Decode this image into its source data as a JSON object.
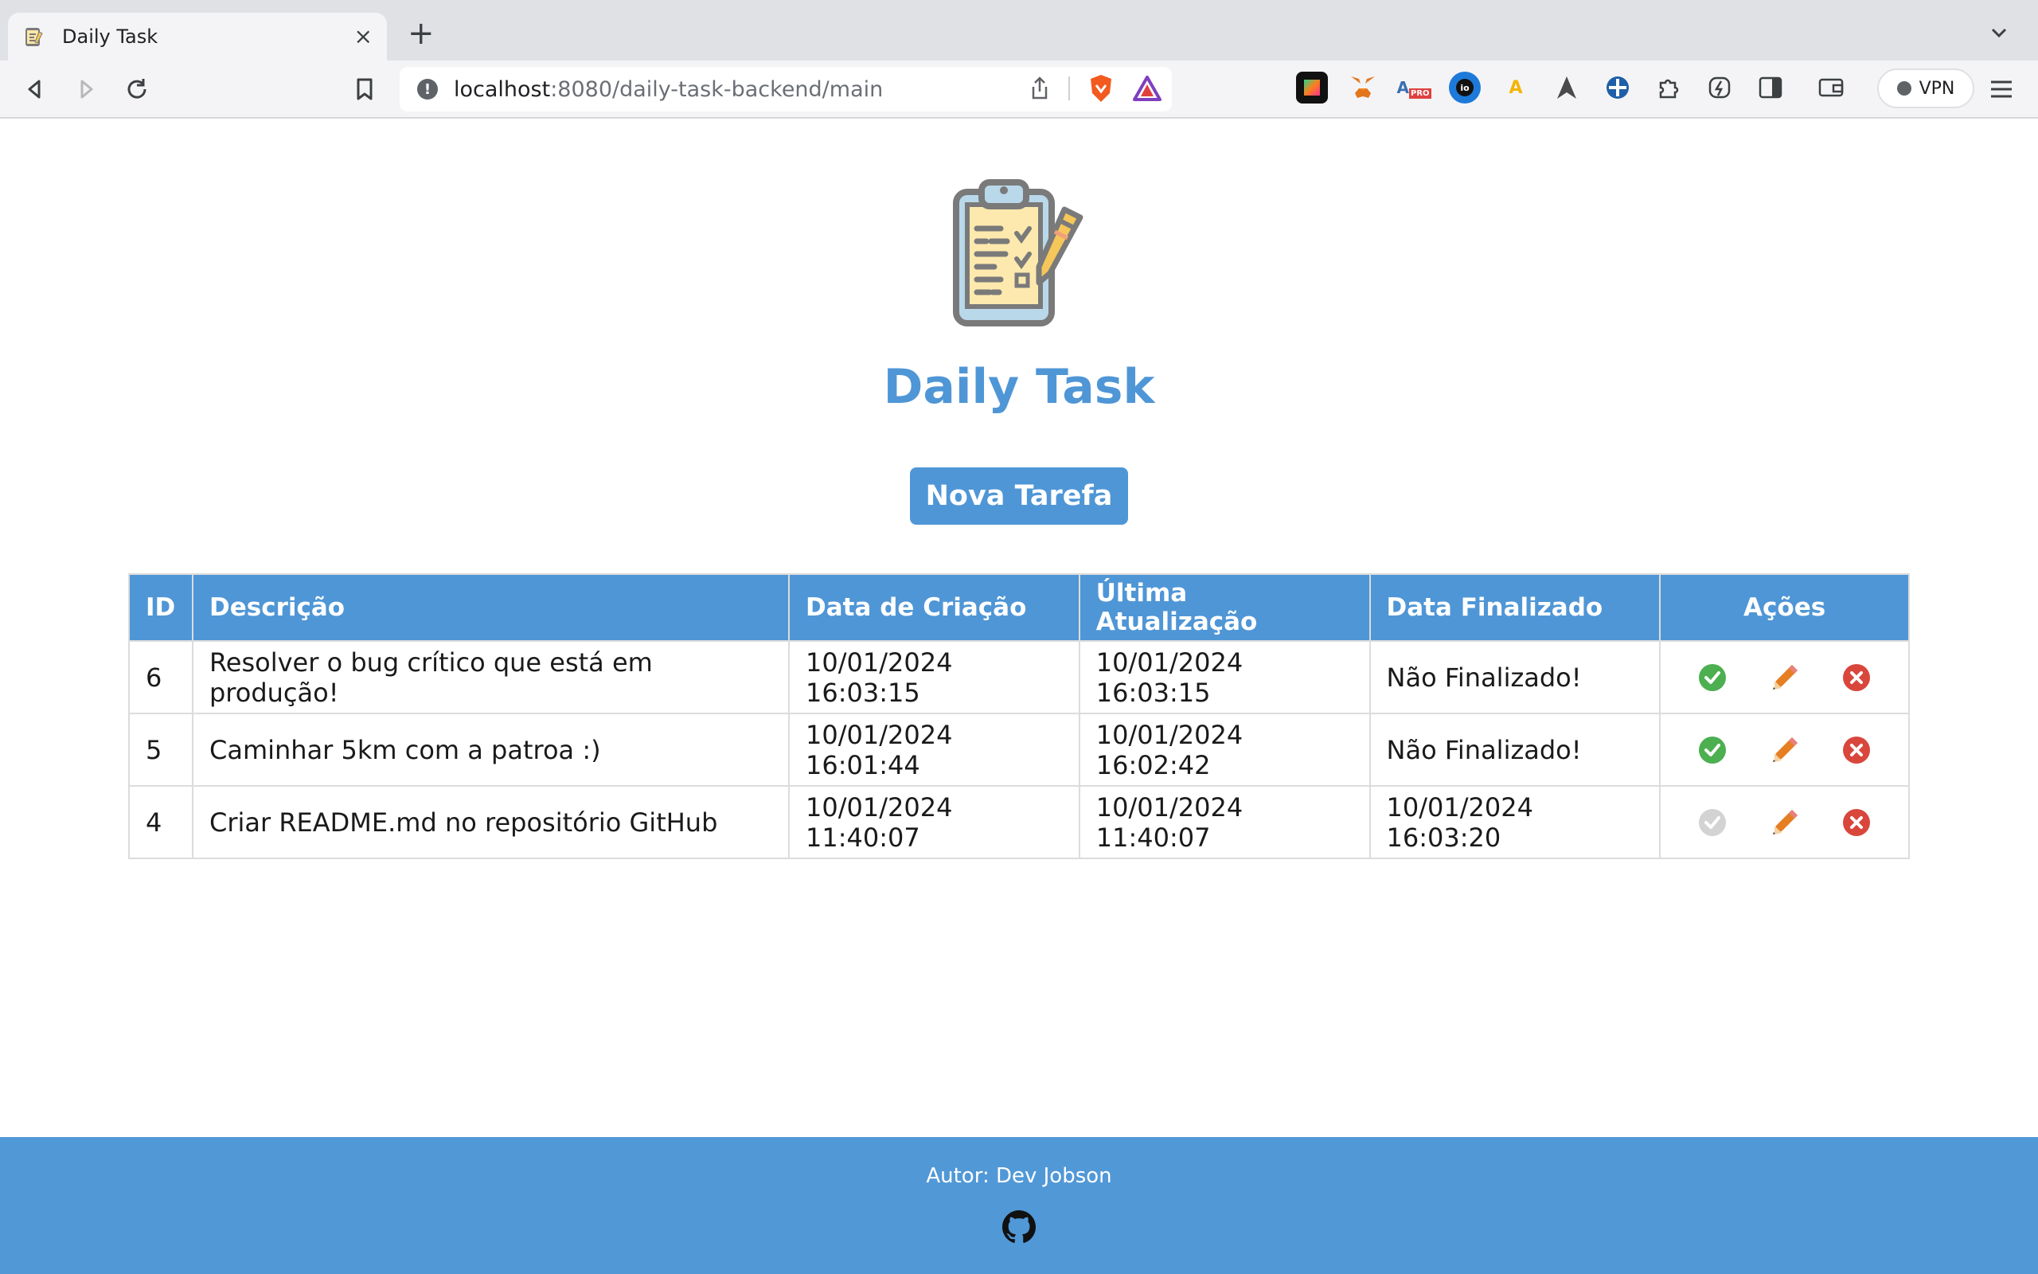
{
  "browser": {
    "tab_title": "Daily Task",
    "url_host": "localhost",
    "url_rest": ":8080/daily-task-backend/main",
    "vpn_label": "VPN"
  },
  "page": {
    "title": "Daily Task",
    "new_task_label": "Nova Tarefa"
  },
  "table": {
    "headers": [
      "ID",
      "Descrição",
      "Data de Criação",
      "Última Atualização",
      "Data Finalizado",
      "Ações"
    ],
    "rows": [
      {
        "id": "6",
        "description": "Resolver o bug crítico que está em produção!",
        "created": "10/01/2024 16:03:15",
        "updated": "10/01/2024 16:03:15",
        "finished": "Não Finalizado!",
        "complete_enabled": true
      },
      {
        "id": "5",
        "description": "Caminhar 5km com a patroa :)",
        "created": "10/01/2024 16:01:44",
        "updated": "10/01/2024 16:02:42",
        "finished": "Não Finalizado!",
        "complete_enabled": true
      },
      {
        "id": "4",
        "description": "Criar README.md no repositório GitHub",
        "created": "10/01/2024 11:40:07",
        "updated": "10/01/2024 11:40:07",
        "finished": "10/01/2024 16:03:20",
        "complete_enabled": false
      }
    ]
  },
  "footer": {
    "author": "Autor: Dev Jobson"
  },
  "colors": {
    "primary": "#4f96d6",
    "footer": "#5198d7",
    "complete": "#4caf50",
    "complete_disabled": "#d3d3d3",
    "edit": "#e67e22",
    "delete": "#d9463c"
  }
}
